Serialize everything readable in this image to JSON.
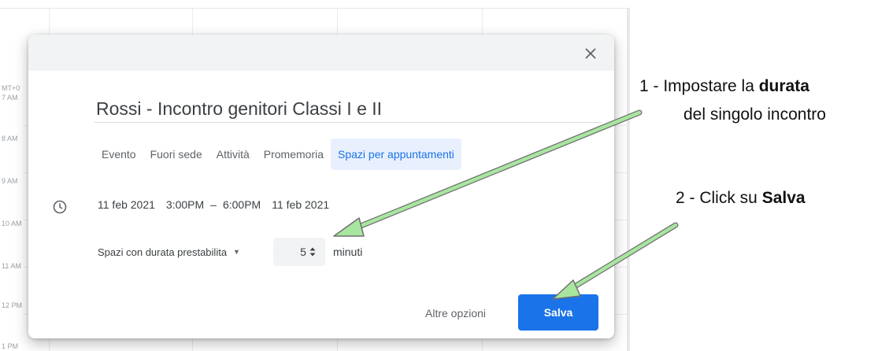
{
  "calendar": {
    "time_labels": [
      "MT+0",
      "7 AM",
      "8 AM",
      "9 AM",
      "10 AM",
      "11 AM",
      "12 PM",
      "1 PM"
    ]
  },
  "dialog": {
    "close_icon": "close-icon",
    "title_value": "Rossi - Incontro genitori Classi I e II",
    "tabs": [
      {
        "label": "Evento"
      },
      {
        "label": "Fuori sede"
      },
      {
        "label": "Attività"
      },
      {
        "label": "Promemoria"
      },
      {
        "label": "Spazi per appuntamenti",
        "active": true
      }
    ],
    "clock_icon": "clock-icon",
    "start_date": "11 feb 2021",
    "start_time": "3:00PM",
    "separator": "–",
    "end_time": "6:00PM",
    "end_date": "11 feb 2021",
    "slot_type": "Spazi con durata prestabilita",
    "duration_value": "5",
    "duration_unit": "minuti",
    "more_options_label": "Altre opzioni",
    "save_label": "Salva",
    "accent_color": "#1a73e8"
  },
  "annotations": {
    "step1_prefix": "1 - Impostare la ",
    "step1_bold": "durata",
    "step1_line2": "del singolo incontro",
    "step2_prefix": "2 - Click su ",
    "step2_bold": "Salva",
    "arrow_color": "#a8e6a0"
  }
}
